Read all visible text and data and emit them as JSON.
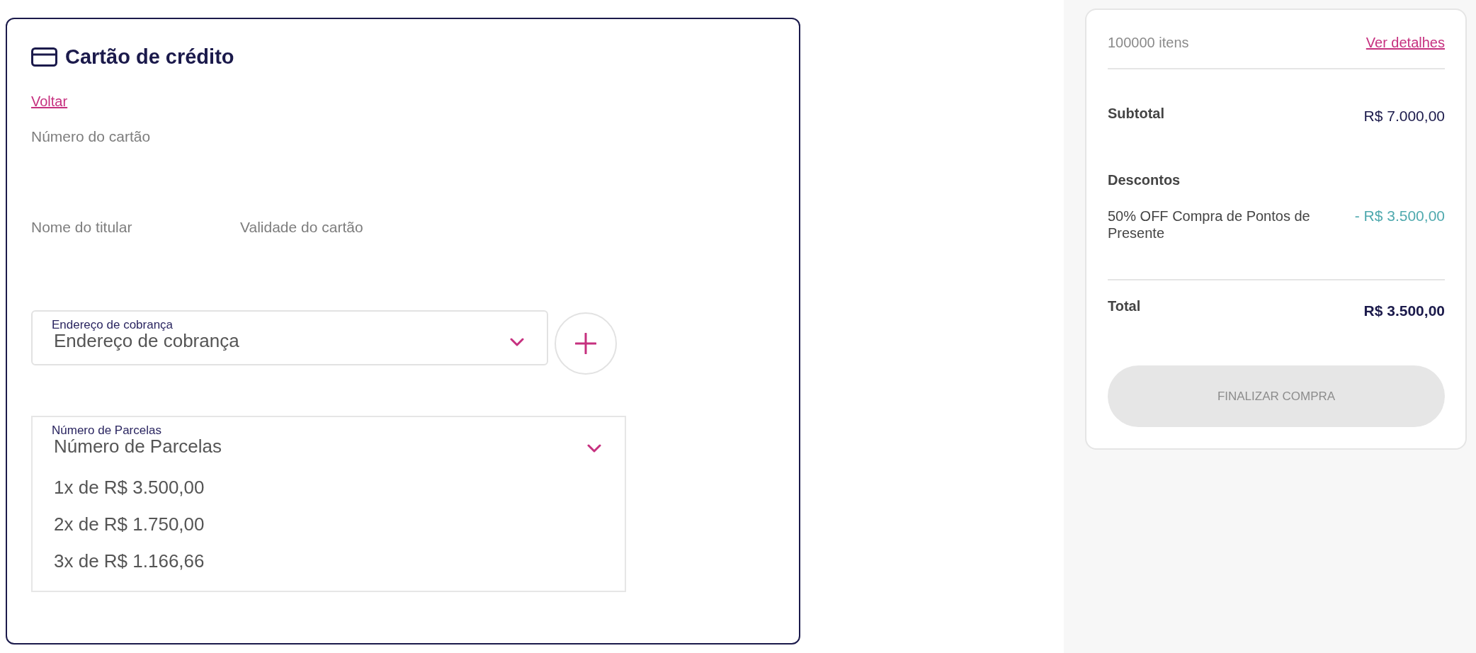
{
  "payment": {
    "title": "Cartão de crédito",
    "back_link": "Voltar",
    "card_number_label": "Número do cartão",
    "holder_name_label": "Nome do titular",
    "expiry_label": "Validade do cartão",
    "billing_address": {
      "label": "Endereço de cobrança",
      "value": "Endereço de cobrança"
    },
    "installments": {
      "label": "Número de Parcelas",
      "value": "Número de Parcelas",
      "expanded": true,
      "options": [
        {
          "label": "1x de R$ 3.500,00",
          "selected": false
        },
        {
          "label": "2x de R$ 1.750,00",
          "selected": false
        },
        {
          "label": "3x de R$ 1.166,66",
          "selected": false
        }
      ]
    }
  },
  "order_summary": {
    "item_count": "100000 itens",
    "details_link": "Ver detalhes",
    "subtotal": {
      "label": "Subtotal",
      "value": "R$ 7.000,00"
    },
    "discounts_title": "Descontos",
    "discounts": [
      {
        "label": "50% OFF Compra de Pontos de Presente",
        "value": "- R$ 3.500,00"
      }
    ],
    "total": {
      "label": "Total",
      "value": "R$ 3.500,00"
    },
    "checkout_button": {
      "label": "FINALIZAR COMPRA",
      "disabled": true
    }
  }
}
